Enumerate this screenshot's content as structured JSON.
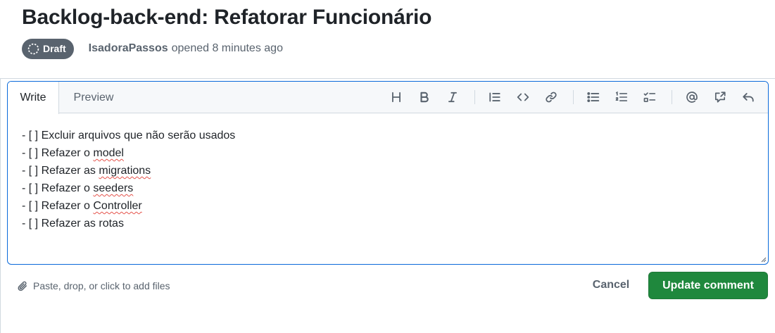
{
  "header": {
    "title": "Backlog-back-end: Refatorar Funcionário",
    "draft_label": "Draft",
    "author": "IsadoraPassos",
    "opened_text": "opened 8 minutes ago"
  },
  "editor": {
    "tabs": [
      {
        "label": "Write",
        "active": true
      },
      {
        "label": "Preview",
        "active": false
      }
    ],
    "toolbar_icons": [
      "heading-icon",
      "bold-icon",
      "italic-icon",
      "quote-icon",
      "code-icon",
      "link-icon",
      "unordered-list-icon",
      "ordered-list-icon",
      "task-list-icon",
      "mention-icon",
      "cross-reference-icon",
      "saved-replies-icon"
    ],
    "lines": [
      {
        "prefix": "- [ ] ",
        "text": "Excluir arquivos que não serão usados",
        "pre": "",
        "word": "",
        "post": ""
      },
      {
        "prefix": "- [ ] ",
        "text": "",
        "pre": "Refazer o ",
        "word": "model",
        "post": ""
      },
      {
        "prefix": "- [ ] ",
        "text": "",
        "pre": "Refazer as ",
        "word": "migrations",
        "post": ""
      },
      {
        "prefix": "- [ ] ",
        "text": "",
        "pre": "Refazer o ",
        "word": "seeders",
        "post": ""
      },
      {
        "prefix": "- [ ] ",
        "text": "",
        "pre": "Refazer o ",
        "word": "Controller",
        "post": ""
      },
      {
        "prefix": "- [ ] ",
        "text": "Refazer as rotas",
        "pre": "",
        "word": "",
        "post": ""
      }
    ]
  },
  "footer": {
    "attach_text": "Paste, drop, or click to add files",
    "cancel_label": "Cancel",
    "update_label": "Update comment"
  },
  "colors": {
    "primary_button": "#1f883d",
    "focus_border": "#0969da",
    "badge": "#59636e",
    "muted_text": "#59636e"
  }
}
